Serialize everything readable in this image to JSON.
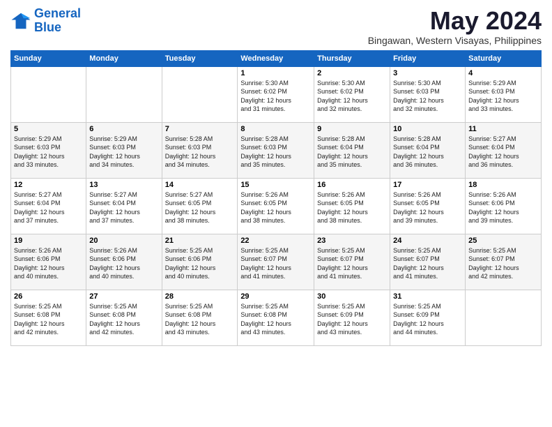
{
  "header": {
    "logo_line1": "General",
    "logo_line2": "Blue",
    "month": "May 2024",
    "location": "Bingawan, Western Visayas, Philippines"
  },
  "weekdays": [
    "Sunday",
    "Monday",
    "Tuesday",
    "Wednesday",
    "Thursday",
    "Friday",
    "Saturday"
  ],
  "weeks": [
    [
      {
        "day": "",
        "info": ""
      },
      {
        "day": "",
        "info": ""
      },
      {
        "day": "",
        "info": ""
      },
      {
        "day": "1",
        "info": "Sunrise: 5:30 AM\nSunset: 6:02 PM\nDaylight: 12 hours\nand 31 minutes."
      },
      {
        "day": "2",
        "info": "Sunrise: 5:30 AM\nSunset: 6:02 PM\nDaylight: 12 hours\nand 32 minutes."
      },
      {
        "day": "3",
        "info": "Sunrise: 5:30 AM\nSunset: 6:03 PM\nDaylight: 12 hours\nand 32 minutes."
      },
      {
        "day": "4",
        "info": "Sunrise: 5:29 AM\nSunset: 6:03 PM\nDaylight: 12 hours\nand 33 minutes."
      }
    ],
    [
      {
        "day": "5",
        "info": "Sunrise: 5:29 AM\nSunset: 6:03 PM\nDaylight: 12 hours\nand 33 minutes."
      },
      {
        "day": "6",
        "info": "Sunrise: 5:29 AM\nSunset: 6:03 PM\nDaylight: 12 hours\nand 34 minutes."
      },
      {
        "day": "7",
        "info": "Sunrise: 5:28 AM\nSunset: 6:03 PM\nDaylight: 12 hours\nand 34 minutes."
      },
      {
        "day": "8",
        "info": "Sunrise: 5:28 AM\nSunset: 6:03 PM\nDaylight: 12 hours\nand 35 minutes."
      },
      {
        "day": "9",
        "info": "Sunrise: 5:28 AM\nSunset: 6:04 PM\nDaylight: 12 hours\nand 35 minutes."
      },
      {
        "day": "10",
        "info": "Sunrise: 5:28 AM\nSunset: 6:04 PM\nDaylight: 12 hours\nand 36 minutes."
      },
      {
        "day": "11",
        "info": "Sunrise: 5:27 AM\nSunset: 6:04 PM\nDaylight: 12 hours\nand 36 minutes."
      }
    ],
    [
      {
        "day": "12",
        "info": "Sunrise: 5:27 AM\nSunset: 6:04 PM\nDaylight: 12 hours\nand 37 minutes."
      },
      {
        "day": "13",
        "info": "Sunrise: 5:27 AM\nSunset: 6:04 PM\nDaylight: 12 hours\nand 37 minutes."
      },
      {
        "day": "14",
        "info": "Sunrise: 5:27 AM\nSunset: 6:05 PM\nDaylight: 12 hours\nand 38 minutes."
      },
      {
        "day": "15",
        "info": "Sunrise: 5:26 AM\nSunset: 6:05 PM\nDaylight: 12 hours\nand 38 minutes."
      },
      {
        "day": "16",
        "info": "Sunrise: 5:26 AM\nSunset: 6:05 PM\nDaylight: 12 hours\nand 38 minutes."
      },
      {
        "day": "17",
        "info": "Sunrise: 5:26 AM\nSunset: 6:05 PM\nDaylight: 12 hours\nand 39 minutes."
      },
      {
        "day": "18",
        "info": "Sunrise: 5:26 AM\nSunset: 6:06 PM\nDaylight: 12 hours\nand 39 minutes."
      }
    ],
    [
      {
        "day": "19",
        "info": "Sunrise: 5:26 AM\nSunset: 6:06 PM\nDaylight: 12 hours\nand 40 minutes."
      },
      {
        "day": "20",
        "info": "Sunrise: 5:26 AM\nSunset: 6:06 PM\nDaylight: 12 hours\nand 40 minutes."
      },
      {
        "day": "21",
        "info": "Sunrise: 5:25 AM\nSunset: 6:06 PM\nDaylight: 12 hours\nand 40 minutes."
      },
      {
        "day": "22",
        "info": "Sunrise: 5:25 AM\nSunset: 6:07 PM\nDaylight: 12 hours\nand 41 minutes."
      },
      {
        "day": "23",
        "info": "Sunrise: 5:25 AM\nSunset: 6:07 PM\nDaylight: 12 hours\nand 41 minutes."
      },
      {
        "day": "24",
        "info": "Sunrise: 5:25 AM\nSunset: 6:07 PM\nDaylight: 12 hours\nand 41 minutes."
      },
      {
        "day": "25",
        "info": "Sunrise: 5:25 AM\nSunset: 6:07 PM\nDaylight: 12 hours\nand 42 minutes."
      }
    ],
    [
      {
        "day": "26",
        "info": "Sunrise: 5:25 AM\nSunset: 6:08 PM\nDaylight: 12 hours\nand 42 minutes."
      },
      {
        "day": "27",
        "info": "Sunrise: 5:25 AM\nSunset: 6:08 PM\nDaylight: 12 hours\nand 42 minutes."
      },
      {
        "day": "28",
        "info": "Sunrise: 5:25 AM\nSunset: 6:08 PM\nDaylight: 12 hours\nand 43 minutes."
      },
      {
        "day": "29",
        "info": "Sunrise: 5:25 AM\nSunset: 6:08 PM\nDaylight: 12 hours\nand 43 minutes."
      },
      {
        "day": "30",
        "info": "Sunrise: 5:25 AM\nSunset: 6:09 PM\nDaylight: 12 hours\nand 43 minutes."
      },
      {
        "day": "31",
        "info": "Sunrise: 5:25 AM\nSunset: 6:09 PM\nDaylight: 12 hours\nand 44 minutes."
      },
      {
        "day": "",
        "info": ""
      }
    ]
  ]
}
